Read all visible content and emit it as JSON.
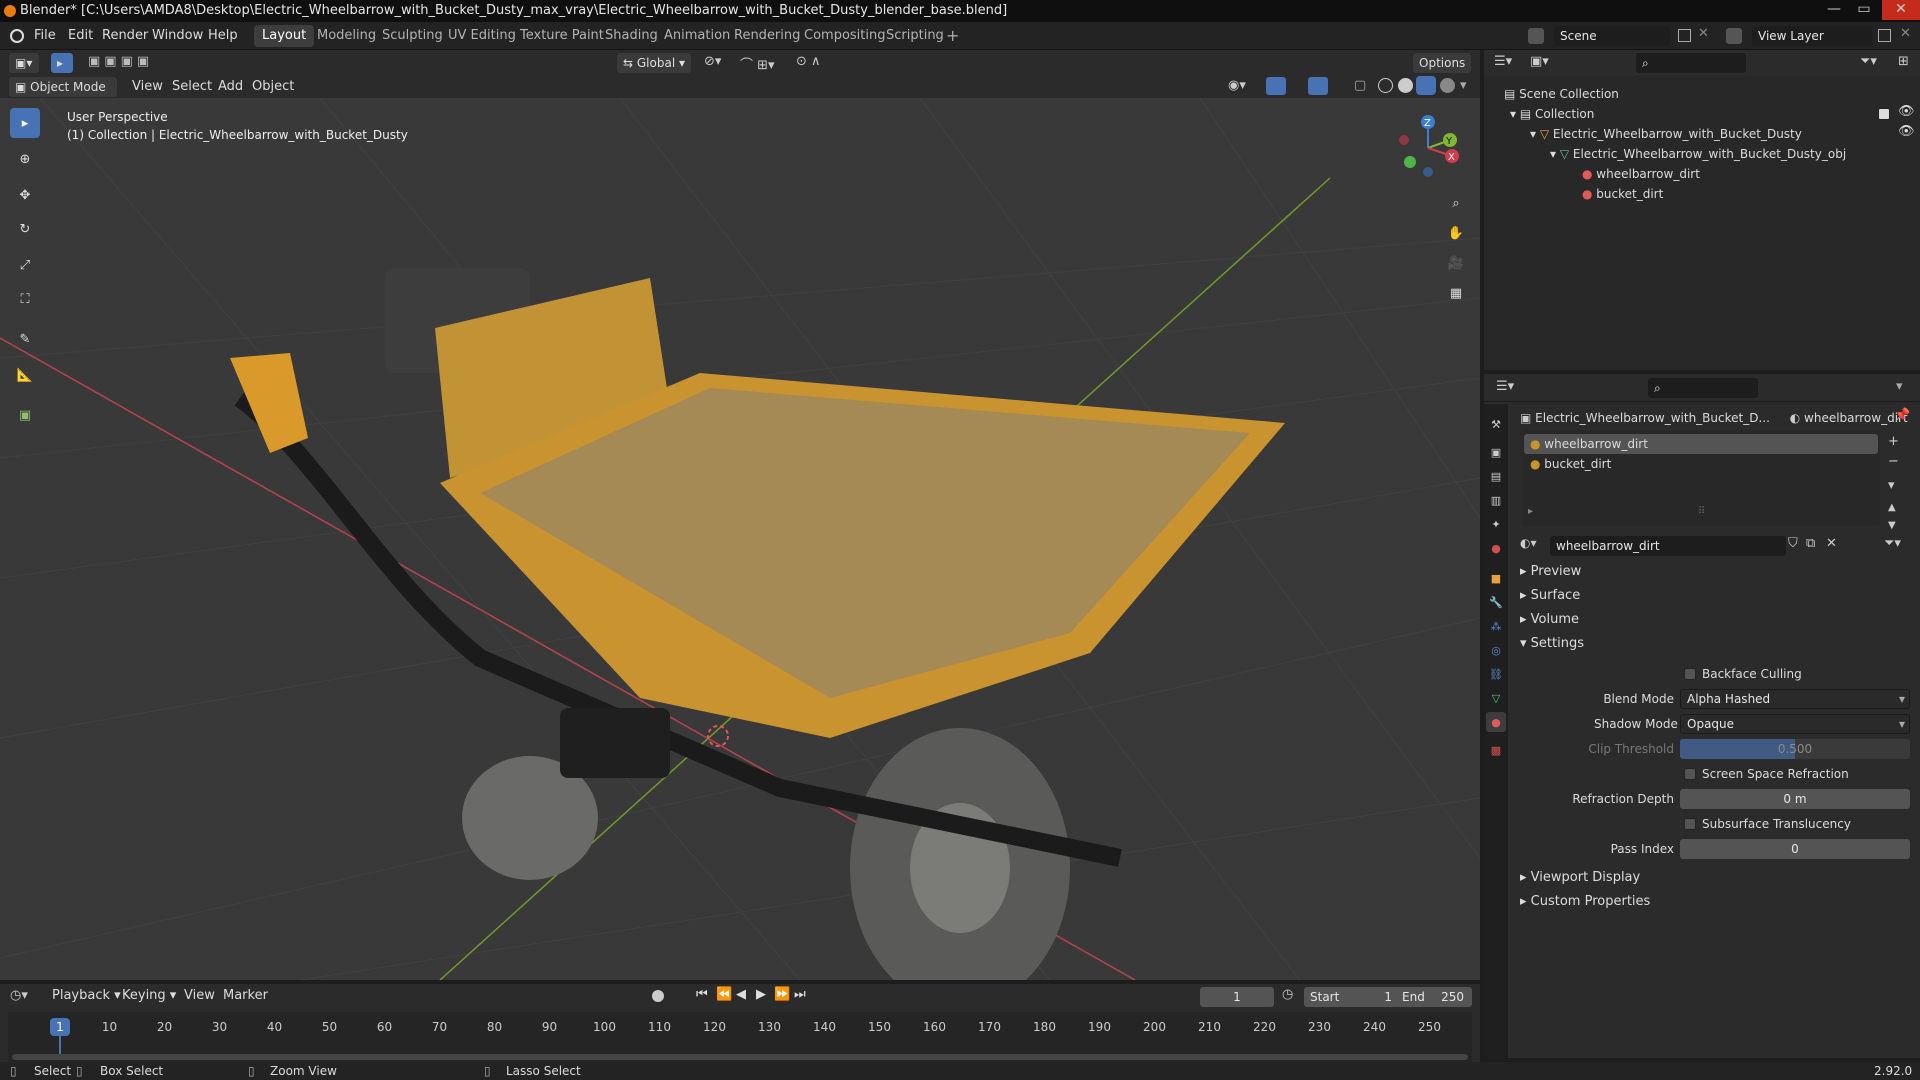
{
  "titlebar": {
    "title": "Blender* [C:\\Users\\AMDA8\\Desktop\\Electric_Wheelbarrow_with_Bucket_Dusty_max_vray\\Electric_Wheelbarrow_with_Bucket_Dusty_blender_base.blend]"
  },
  "menu": {
    "items": [
      "File",
      "Edit",
      "Render",
      "Window",
      "Help"
    ]
  },
  "workspaces": {
    "tabs": [
      "Layout",
      "Modeling",
      "Sculpting",
      "UV Editing",
      "Texture Paint",
      "Shading",
      "Animation",
      "Rendering",
      "Compositing",
      "Scripting"
    ],
    "active": "Layout"
  },
  "scene": {
    "label": "Scene",
    "view_layer": "View Layer"
  },
  "viewport_header": {
    "transform_orientation": "Global",
    "options": "Options",
    "mode": "Object Mode",
    "menus": [
      "View",
      "Select",
      "Add",
      "Object"
    ]
  },
  "viewport": {
    "perspective": "User Perspective",
    "collection_info": "(1) Collection | Electric_Wheelbarrow_with_Bucket_Dusty",
    "gizmo_axes": {
      "x": "X",
      "y": "Y",
      "z": "Z"
    }
  },
  "outliner": {
    "root": "Scene Collection",
    "collection": "Collection",
    "object": "Electric_Wheelbarrow_with_Bucket_Dusty",
    "mesh": "Electric_Wheelbarrow_with_Bucket_Dusty_obj",
    "materials": [
      "wheelbarrow_dirt",
      "bucket_dirt"
    ]
  },
  "properties": {
    "breadcrumb_object": "Electric_Wheelbarrow_with_Bucket_D...",
    "breadcrumb_material": "wheelbarrow_dirt",
    "slots": [
      "wheelbarrow_dirt",
      "bucket_dirt"
    ],
    "material_name": "wheelbarrow_dirt",
    "panels": {
      "preview": "Preview",
      "surface": "Surface",
      "volume": "Volume",
      "settings": "Settings",
      "viewport_display": "Viewport Display",
      "custom_properties": "Custom Properties"
    },
    "settings": {
      "backface_culling": "Backface Culling",
      "blend_mode_label": "Blend Mode",
      "blend_mode": "Alpha Hashed",
      "shadow_mode_label": "Shadow Mode",
      "shadow_mode": "Opaque",
      "clip_threshold_label": "Clip Threshold",
      "clip_threshold": "0.500",
      "screen_space_refraction": "Screen Space Refraction",
      "refraction_depth_label": "Refraction Depth",
      "refraction_depth": "0 m",
      "subsurface_translucency": "Subsurface Translucency",
      "pass_index_label": "Pass Index",
      "pass_index": "0"
    }
  },
  "timeline": {
    "menus": [
      "Playback",
      "Keying",
      "View",
      "Marker"
    ],
    "current_frame": "1",
    "start_label": "Start",
    "start": "1",
    "end_label": "End",
    "end": "250",
    "ticks": [
      "1",
      "10",
      "20",
      "30",
      "40",
      "50",
      "60",
      "70",
      "80",
      "90",
      "100",
      "110",
      "120",
      "130",
      "140",
      "150",
      "160",
      "170",
      "180",
      "190",
      "200",
      "210",
      "220",
      "230",
      "240",
      "250"
    ]
  },
  "statusbar": {
    "select": "Select",
    "box_select": "Box Select",
    "zoom_view": "Zoom View",
    "lasso_select": "Lasso Select",
    "version": "2.92.0"
  },
  "colors": {
    "accent": "#4772b3",
    "bucket": "#c9932f",
    "x_axis": "#d23b4b",
    "y_axis": "#7fb82c",
    "z_axis": "#3b7fd2"
  }
}
